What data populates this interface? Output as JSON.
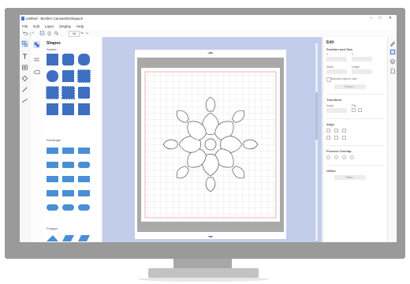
{
  "app": {
    "title": "untitled - Brother CanvasWorkspace",
    "window_controls": [
      "–",
      "□",
      "✕"
    ],
    "icon": "app-icon"
  },
  "menu": [
    "File",
    "Edit",
    "Layer",
    "Display",
    "Help"
  ],
  "toolbar": {
    "zoom_value": "39",
    "zoom_unit": "%"
  },
  "shapes_panel": {
    "title": "Shapes",
    "sections": [
      "Square",
      "Rectangle",
      "Polygon"
    ]
  },
  "edit_panel": {
    "title": "Edit",
    "position_size": "Position and Size",
    "x_label": "X",
    "y_label": "Y",
    "width_label": "Width",
    "height_label": "Height",
    "maintain_aspect": "Maintain aspect ratio",
    "resize_button": "Resize...",
    "transform": "Transform",
    "angle_label": "Angle",
    "flip_label": "Flip",
    "align": "Align",
    "process_overlap": "Process Overlap",
    "offset": "Offset",
    "offset_button": "Offset..."
  },
  "colors": {
    "accent": "#3b6fc4",
    "canvas_bg": "#c2cdec",
    "shape_fill": "#3e6fc2",
    "rect_fill": "#4a8fd6",
    "mat_grid": "#d6d6d6",
    "mat_border": "#e3a3a3"
  }
}
